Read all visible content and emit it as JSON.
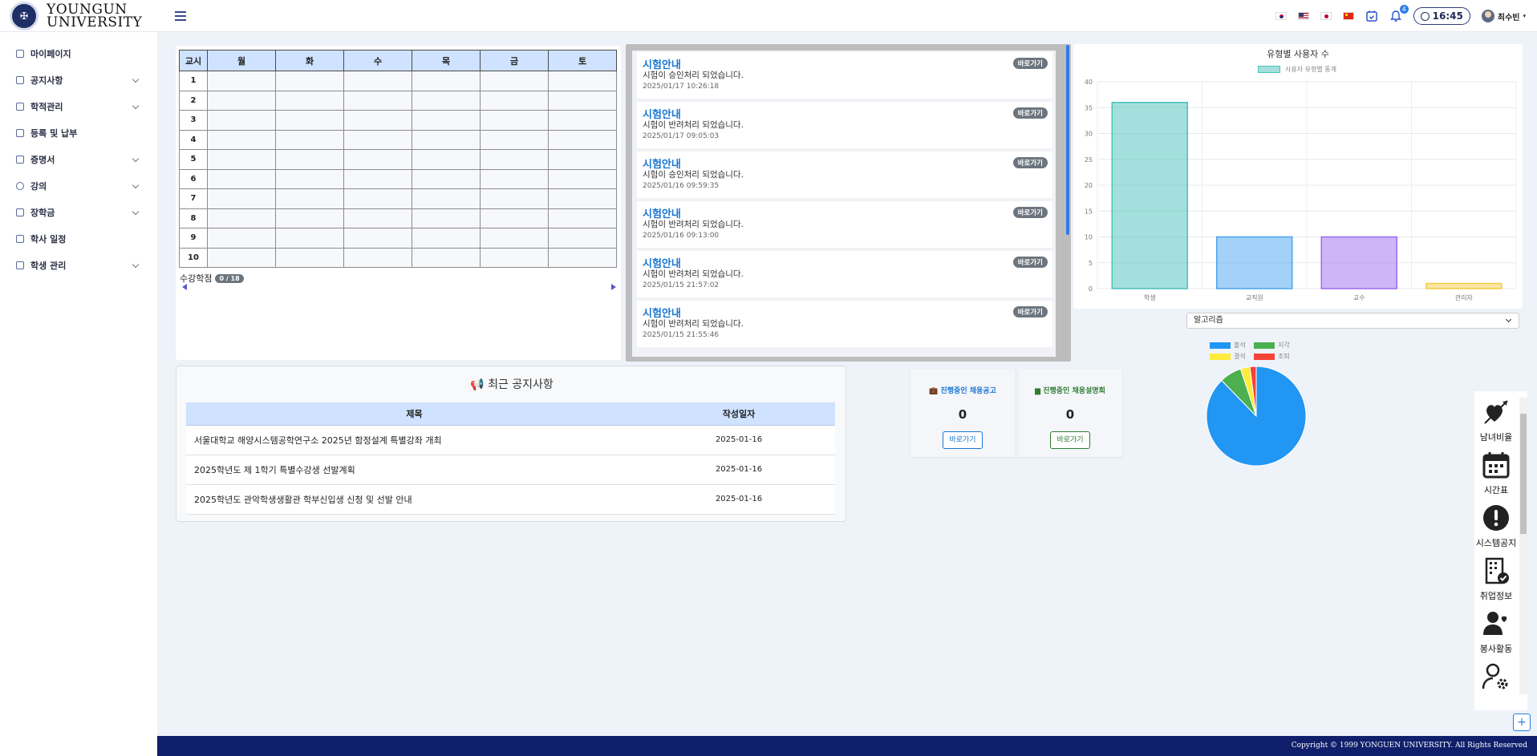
{
  "header": {
    "logo_line1": "YOUNGUN",
    "logo_line2": "UNIVERSITY",
    "notifications_count": "4",
    "time": "16:45",
    "user_name": "최수빈"
  },
  "sidebar": {
    "items": [
      {
        "label": "마이페이지",
        "has_children": false
      },
      {
        "label": "공지사항",
        "has_children": true
      },
      {
        "label": "학적관리",
        "has_children": true
      },
      {
        "label": "등록 및 납부",
        "has_children": false
      },
      {
        "label": "증명서",
        "has_children": true
      },
      {
        "label": "강의",
        "has_children": true
      },
      {
        "label": "장학금",
        "has_children": true
      },
      {
        "label": "학사 일정",
        "has_children": false
      },
      {
        "label": "학생 관리",
        "has_children": true
      }
    ]
  },
  "timetable": {
    "headers": [
      "교시",
      "월",
      "화",
      "수",
      "목",
      "금",
      "토"
    ],
    "periods": [
      "1",
      "2",
      "3",
      "4",
      "5",
      "6",
      "7",
      "8",
      "9",
      "10"
    ],
    "credit_label": "수강학점",
    "credit_value": "0 / 18"
  },
  "exam_notices": {
    "go_label": "바로가기",
    "items": [
      {
        "title": "시험안내",
        "message": "시험이 승인처리 되었습니다.",
        "date": "2025/01/17 10:26:18"
      },
      {
        "title": "시험안내",
        "message": "시험이 반려처리 되었습니다.",
        "date": "2025/01/17 09:05:03"
      },
      {
        "title": "시험안내",
        "message": "시험이 승인처리 되었습니다.",
        "date": "2025/01/16 09:59:35"
      },
      {
        "title": "시험안내",
        "message": "시험이 반려처리 되었습니다.",
        "date": "2025/01/16 09:13:00"
      },
      {
        "title": "시험안내",
        "message": "시험이 반려처리 되었습니다.",
        "date": "2025/01/15 21:57:02"
      },
      {
        "title": "시험안내",
        "message": "시험이 반려처리 되었습니다.",
        "date": "2025/01/15 21:55:46"
      }
    ]
  },
  "chart_data": [
    {
      "type": "bar",
      "title": "유형별 사용자 수",
      "categories": [
        "학생",
        "교직원",
        "교수",
        "관리자"
      ],
      "series": [
        {
          "name": "사용자 유형별 통계",
          "values": [
            36,
            10,
            10,
            1
          ]
        }
      ],
      "colors": [
        "#48c1bb",
        "#4aa3ef",
        "#9b6cf0",
        "#f3cc45"
      ],
      "ylim": [
        0,
        40
      ],
      "yticks": [
        0,
        5,
        10,
        15,
        20,
        25,
        30,
        35,
        40
      ],
      "grid": true,
      "legend": "top"
    },
    {
      "type": "pie",
      "categories": [
        "출석",
        "지각",
        "결석",
        "조퇴"
      ],
      "values": [
        86,
        7,
        3,
        2
      ],
      "colors": [
        "#2196f3",
        "#4caf50",
        "#ffeb3b",
        "#f44336"
      ],
      "legend": "top"
    }
  ],
  "select": {
    "value": "알고리즘"
  },
  "notices": {
    "title": "최근 공지사항",
    "col_title": "제목",
    "col_date": "작성일자",
    "rows": [
      {
        "title": "서울대학교 해양시스템공학연구소 2025년 함정설계 특별강좌 개최",
        "date": "2025-01-16"
      },
      {
        "title": "2025학년도 제 1학기 특별수강생 선발계획",
        "date": "2025-01-16"
      },
      {
        "title": "2025학년도 관악학생생활관 학부신입생 신청 및 선발 안내",
        "date": "2025-01-16"
      }
    ]
  },
  "jobs": {
    "recruit_label": "진행중인 채용공고",
    "recruit_count": "0",
    "session_label": "진행중인 채용설명회",
    "session_count": "0",
    "go_label": "바로가기",
    "recruit_color": "#1976d2",
    "session_color": "#2e7d32"
  },
  "quick_menu": {
    "items": [
      {
        "label": "남녀비율",
        "icon": "cupid-heart-icon"
      },
      {
        "label": "시간표",
        "icon": "calendar-icon"
      },
      {
        "label": "시스템공지",
        "icon": "alert-icon"
      },
      {
        "label": "취업정보",
        "icon": "building-check-icon"
      },
      {
        "label": "봉사활동",
        "icon": "volunteer-icon"
      },
      {
        "label": "",
        "icon": "user-settings-icon"
      }
    ]
  },
  "footer": {
    "copyright": "Copyright © 1999 YONGUEN UNIVERSITY. All Rights Reserved"
  }
}
